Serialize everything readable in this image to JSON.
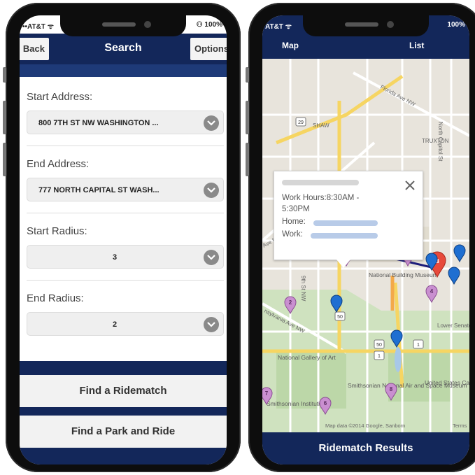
{
  "left_phone": {
    "status": {
      "carrier": "••AT&T ᯤ",
      "battery": "⚇ 100%"
    },
    "header": {
      "back_label": "Back",
      "title": "Search",
      "options_label": "Options"
    },
    "form": {
      "start_address": {
        "label": "Start Address:",
        "value": "800 7TH ST NW WASHINGTON ..."
      },
      "end_address": {
        "label": "End Address:",
        "value": "777 NORTH CAPITAL ST WASH..."
      },
      "start_radius": {
        "label": "Start Radius:",
        "value": "3"
      },
      "end_radius": {
        "label": "End Radius:",
        "value": "2"
      }
    },
    "actions": {
      "find_ridematch": "Find a Ridematch",
      "find_park_ride": "Find a Park and Ride"
    }
  },
  "right_phone": {
    "status": {
      "carrier": "AT&T ᯤ",
      "battery": "100%"
    },
    "tabs": {
      "map": "Map",
      "list": "List"
    },
    "popup": {
      "work_hours": "Work Hours:8:30AM -",
      "work_hours_end": "5:30PM",
      "home_label": "Home:",
      "work_label": "Work:"
    },
    "map": {
      "streets": [
        "Florida Ave NW",
        "TRUXTON",
        "SHAW",
        "North Capitol St",
        "9th St NW",
        "Ave NW",
        "nsylvania Ave NW",
        "Lower Senate Pa"
      ],
      "places": [
        "National Building Museum",
        "National Gallery of Art",
        "Smithsonian National Air and Space Museum",
        "Smithsonian Institution",
        "United States Capitol"
      ],
      "route_shields": [
        "29",
        "50",
        "50",
        "1",
        "1"
      ],
      "markers": {
        "start": "A",
        "end": "B",
        "purple": [
          "1",
          "2",
          "3",
          "4",
          "6",
          "7",
          "8"
        ],
        "blue_count": 5
      },
      "attribution": "Map data ©2014 Google, Sanborn",
      "terms": "Terms"
    },
    "bottom_button": "Ridematch Results"
  },
  "colors": {
    "navy": "#13275a",
    "route_line": "#1d1d7a",
    "marker_purple": "#c98fd0",
    "marker_blue": "#1f6fd1",
    "marker_green": "#4aa838",
    "marker_red": "#e74a3b"
  }
}
